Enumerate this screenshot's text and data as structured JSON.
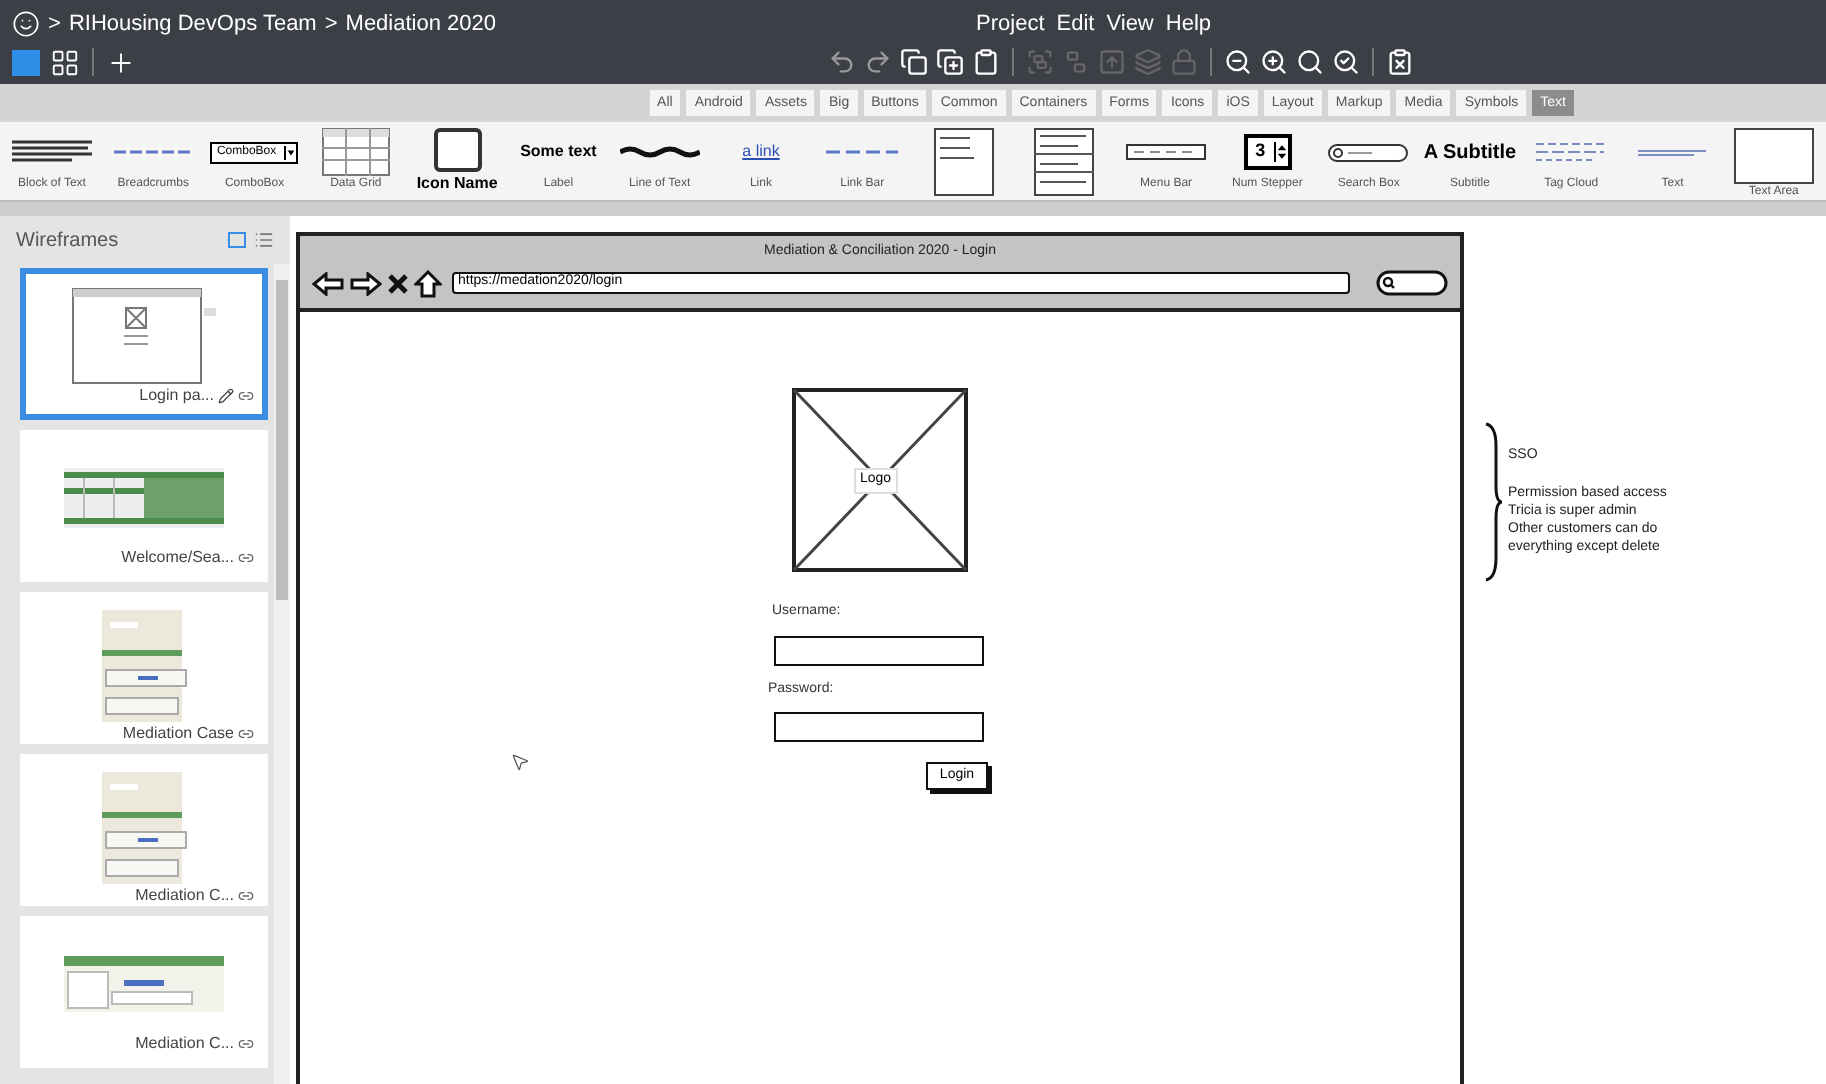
{
  "breadcrumb": {
    "separator": ">",
    "items": [
      "RIHousing DevOps Team",
      "Mediation 2020"
    ]
  },
  "menu": [
    "Project",
    "Edit",
    "View",
    "Help"
  ],
  "library_tabs": [
    {
      "label": "All",
      "selected": false
    },
    {
      "label": "Android",
      "selected": false
    },
    {
      "label": "Assets",
      "selected": false
    },
    {
      "label": "Big",
      "selected": false
    },
    {
      "label": "Buttons",
      "selected": false
    },
    {
      "label": "Common",
      "selected": false
    },
    {
      "label": "Containers",
      "selected": false
    },
    {
      "label": "Forms",
      "selected": false
    },
    {
      "label": "Icons",
      "selected": false
    },
    {
      "label": "iOS",
      "selected": false
    },
    {
      "label": "Layout",
      "selected": false
    },
    {
      "label": "Markup",
      "selected": false
    },
    {
      "label": "Media",
      "selected": false
    },
    {
      "label": "Symbols",
      "selected": false
    },
    {
      "label": "Text",
      "selected": true
    }
  ],
  "components": [
    {
      "kind": "block",
      "label": "Block of Text"
    },
    {
      "kind": "breadcrumbs",
      "label": "Breadcrumbs"
    },
    {
      "kind": "combobox",
      "label": "ComboBox",
      "text": "ComboBox"
    },
    {
      "kind": "grid",
      "label": "Data Grid"
    },
    {
      "kind": "icon",
      "label": "Icon Name"
    },
    {
      "kind": "label",
      "label": "Label",
      "text": "Some text"
    },
    {
      "kind": "scribble",
      "label": "Line of Text"
    },
    {
      "kind": "link",
      "label": "Link",
      "text": "a link"
    },
    {
      "kind": "linkbar",
      "label": "Link Bar"
    },
    {
      "kind": "list"
    },
    {
      "kind": "menu"
    },
    {
      "kind": "menubar",
      "label": "Menu Bar"
    },
    {
      "kind": "stepper",
      "label": "Num Stepper",
      "text": "3"
    },
    {
      "kind": "search",
      "label": "Search Box"
    },
    {
      "kind": "subtitle",
      "label": "Subtitle",
      "text": "A Subtitle"
    },
    {
      "kind": "tagcloud",
      "label": "Tag Cloud"
    },
    {
      "kind": "text",
      "label": "Text"
    },
    {
      "kind": "textarea",
      "label": "Text Area"
    }
  ],
  "wireframes": {
    "title": "Wireframes",
    "items": [
      {
        "label": "Login pa...",
        "kind": "login",
        "selected": true,
        "editing": true
      },
      {
        "label": "Welcome/Sea...",
        "kind": "grid",
        "selected": false,
        "editing": false
      },
      {
        "label": "Mediation Case",
        "kind": "form",
        "selected": false,
        "editing": false
      },
      {
        "label": "Mediation C...",
        "kind": "form",
        "selected": false,
        "editing": false
      },
      {
        "label": "Mediation C...",
        "kind": "banner",
        "selected": false,
        "editing": false
      }
    ]
  },
  "mockup": {
    "title": "Mediation & Conciliation 2020 - Login",
    "url": "https://medation2020/login",
    "logo": "Logo",
    "username_label": "Username:",
    "password_label": "Password:",
    "login_button": "Login"
  },
  "notes": {
    "heading": "SSO",
    "lines": [
      "Permission based access",
      "Tricia is super admin",
      "Other customers can do",
      "everything except delete"
    ]
  }
}
